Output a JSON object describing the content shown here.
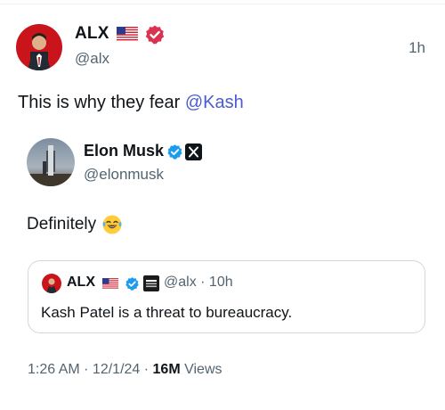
{
  "author": {
    "name": "ALX",
    "handle": "@alx",
    "time": "1h",
    "flag": "us-flag-icon",
    "badge": "verified-badge-icon"
  },
  "tweet": {
    "text_prefix": "This is why they fear ",
    "mention": "@Kash"
  },
  "quoted": {
    "name": "Elon Musk",
    "handle": "@elonmusk",
    "text": "Definitely",
    "emoji": "laughing-tears-emoji",
    "nested": {
      "name": "ALX",
      "handle_time": "@alx · 10h",
      "text": "Kash Patel is a threat to bureaucracy."
    }
  },
  "meta": {
    "time_date": "1:26 AM · 12/1/24 · ",
    "views_count": "16M",
    "views_label": " Views"
  },
  "colors": {
    "accent": "#4a5ccf",
    "verified": "#1d9bf0",
    "affiliate_badge": "#d9334f"
  }
}
